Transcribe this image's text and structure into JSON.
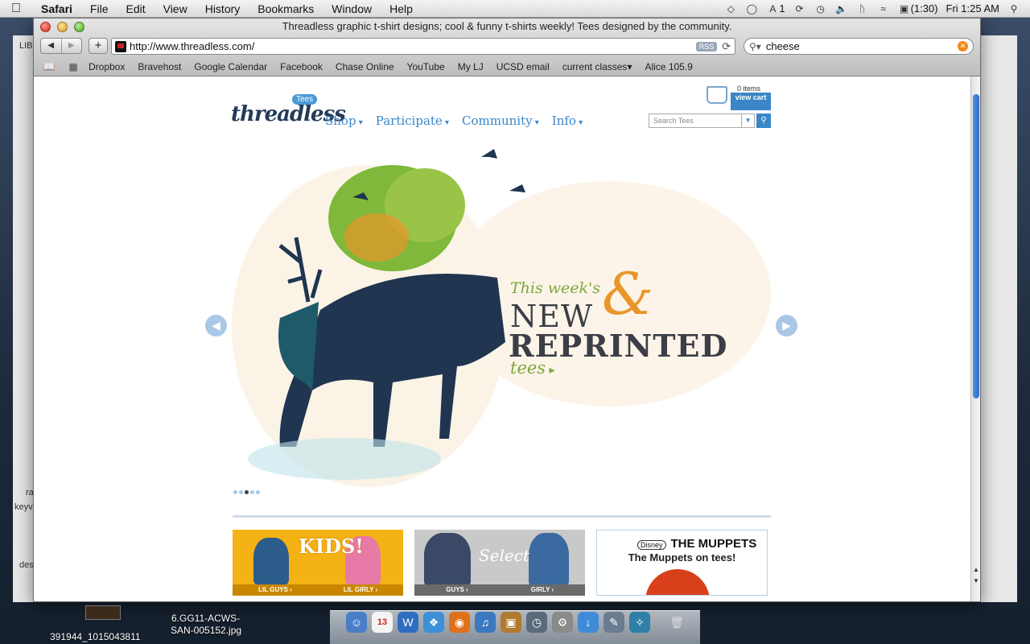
{
  "menubar": {
    "app": "Safari",
    "items": [
      "File",
      "Edit",
      "View",
      "History",
      "Bookmarks",
      "Window",
      "Help"
    ],
    "status": {
      "adobe": "1",
      "battery": "(1:30)",
      "clock": "Fri 1:25 AM"
    }
  },
  "window": {
    "title": "Threadless graphic t-shirt designs; cool & funny t-shirts weekly! Tees designed by the community.",
    "url": "http://www.threadless.com/",
    "rss": "RSS",
    "search_value": "cheese"
  },
  "bookmarks": [
    "Dropbox",
    "Bravehost",
    "Google Calendar",
    "Facebook",
    "Chase Online",
    "YouTube",
    "My LJ",
    "UCSD email",
    "current classes",
    "Alice 105.9"
  ],
  "site": {
    "logo": "threadless",
    "logo_badge": "Tees",
    "nav": [
      "Shop",
      "Participate",
      "Community",
      "Info"
    ],
    "cart": {
      "items": "0 items",
      "button": "view cart"
    },
    "search_placeholder": "Search Tees",
    "hero": {
      "line1": "This week's",
      "line2": "NEW",
      "amp": "&",
      "line3": "REPRINTED",
      "line4": "tees"
    },
    "promos": {
      "kids": {
        "title": "KIDS!",
        "left": "LIL GUYS ›",
        "right": "LIL GIRLY ›"
      },
      "select": {
        "title": "Select",
        "left": "GUYS ›",
        "right": "GIRLY ›"
      },
      "muppets": {
        "disney": "Disney",
        "logo": "THE MUPPETS",
        "tagline": "The Muppets on tees!"
      }
    }
  },
  "desktop": {
    "file1": "391944_1015043811",
    "file2_line1": "6.GG11-ACWS-",
    "file2_line2": "SAN-005152.jpg",
    "bg_label1": "ra",
    "bg_label2": "keyv",
    "bg_label3": "des",
    "bg_label4": "LIB"
  }
}
